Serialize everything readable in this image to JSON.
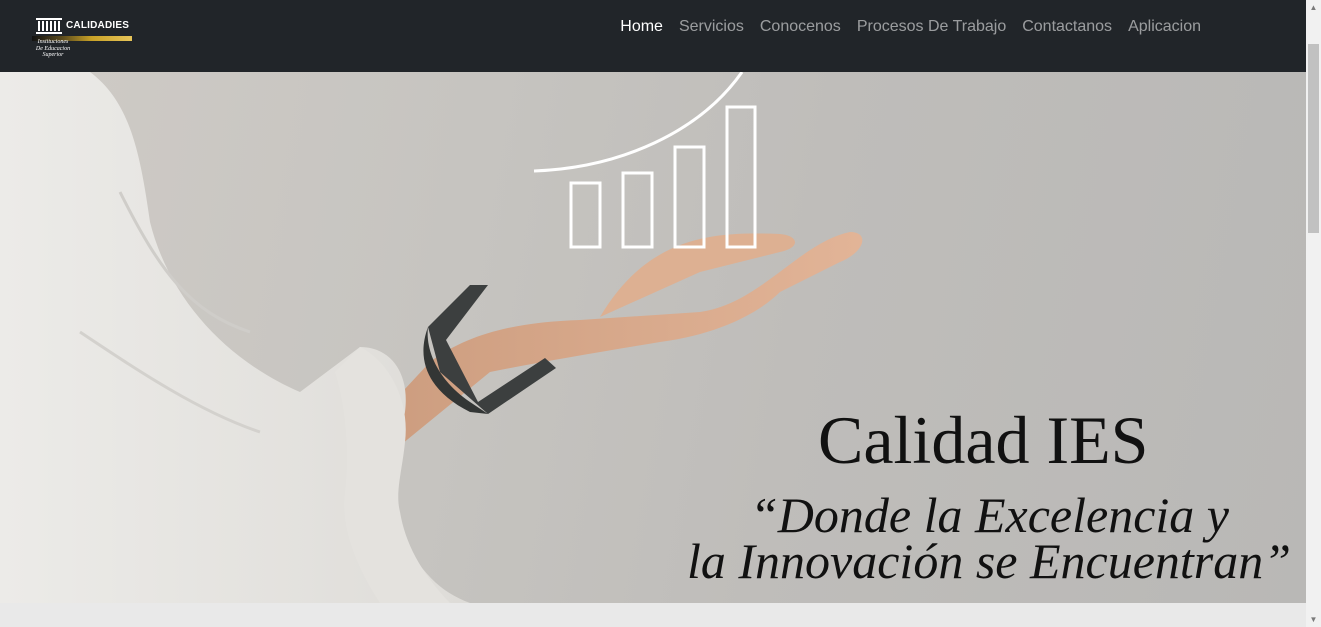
{
  "brand": {
    "name": "CALIDADIES",
    "tagline_line1": "Instituciones",
    "tagline_line2": "De Educacion",
    "tagline_line3": "Superior"
  },
  "nav": {
    "items": [
      {
        "label": "Home",
        "active": true
      },
      {
        "label": "Servicios"
      },
      {
        "label": "Conocenos"
      },
      {
        "label": "Procesos De Trabajo"
      },
      {
        "label": "Contactanos"
      },
      {
        "label": "Aplicacion"
      }
    ]
  },
  "hero": {
    "title": "Calidad IES",
    "quote_line1": "“Donde la Excelencia y",
    "quote_line2": "la Innovación se Encuentran”"
  },
  "colors": {
    "navbar": "#212529",
    "nav_active": "#ffffff",
    "nav_inactive": "rgba(255,255,255,0.55)",
    "logo_gold": "#c9a227"
  },
  "icons": {
    "scroll_up": "▲",
    "scroll_down": "▼"
  }
}
